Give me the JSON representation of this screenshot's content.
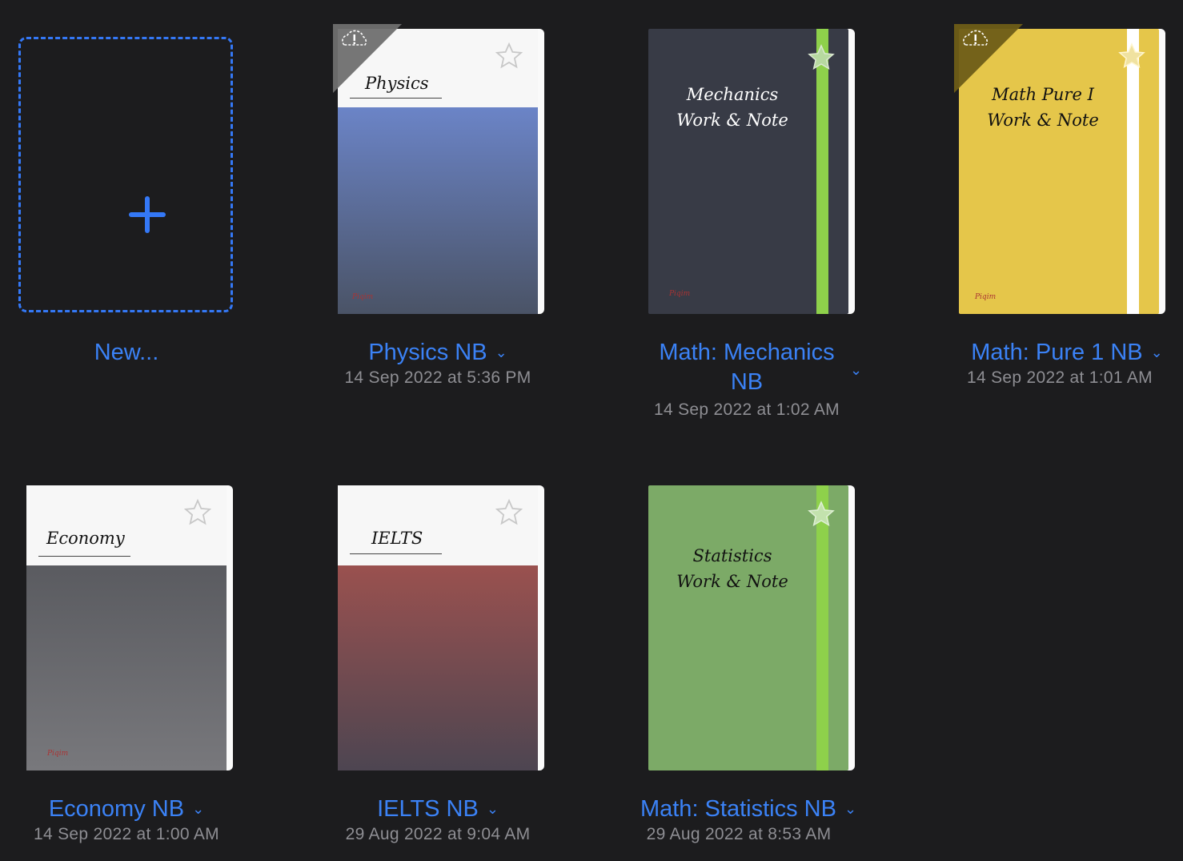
{
  "new_item": {
    "label": "New..."
  },
  "notebooks": [
    {
      "name": "Physics NB",
      "date": "14 Sep 2022 at 5:36 PM",
      "cover_text": "Physics",
      "style": "label-top",
      "gradient": [
        "#6b84c7",
        "#4a5366"
      ],
      "cloud_alert": true,
      "logo": "Piqim"
    },
    {
      "name_line1": "Math: Mechanics",
      "name_line2": "NB",
      "date": "14 Sep 2022 at 1:02 AM",
      "cover_line1": "Mechanics",
      "cover_line2": "Work & Note",
      "style": "elastic",
      "cover_color": "#383b46",
      "elastic_color": "#8ed14b",
      "cloud_alert": false,
      "logo": "Piqim"
    },
    {
      "name": "Math: Pure 1 NB",
      "date": "14 Sep 2022 at 1:01 AM",
      "cover_line1": "Math Pure I",
      "cover_line2": "Work & Note",
      "style": "elastic",
      "cover_color": "#e5c64a",
      "elastic_color": "#ffffff",
      "cloud_alert": true,
      "logo": "Piqim"
    },
    {
      "name": "Economy NB",
      "date": "14 Sep 2022 at 1:00 AM",
      "cover_text": "Economy",
      "style": "label-top",
      "gradient": [
        "#5a5b60",
        "#78787c"
      ],
      "cloud_alert": false,
      "logo": "Piqim"
    },
    {
      "name": "IELTS NB",
      "date": "29 Aug 2022 at 9:04 AM",
      "cover_text": "IELTS",
      "style": "label-top",
      "gradient": [
        "#9a514f",
        "#4d4551"
      ],
      "cloud_alert": false,
      "logo": ""
    },
    {
      "name": "Math: Statistics NB",
      "date": "29 Aug 2022 at 8:53 AM",
      "cover_line1": "Statistics",
      "cover_line2": "Work & Note",
      "style": "elastic",
      "cover_color": "#7caa67",
      "elastic_color": "#8ed14b",
      "cloud_alert": false,
      "logo": ""
    }
  ],
  "icons": {
    "add": "plus-icon",
    "favorite": "star-icon",
    "sync_alert": "cloud-alert-icon",
    "menu": "chevron-down-icon"
  },
  "colors": {
    "accent": "#3b82f6",
    "background": "#1c1c1e",
    "secondary_text": "#8e8e93"
  }
}
